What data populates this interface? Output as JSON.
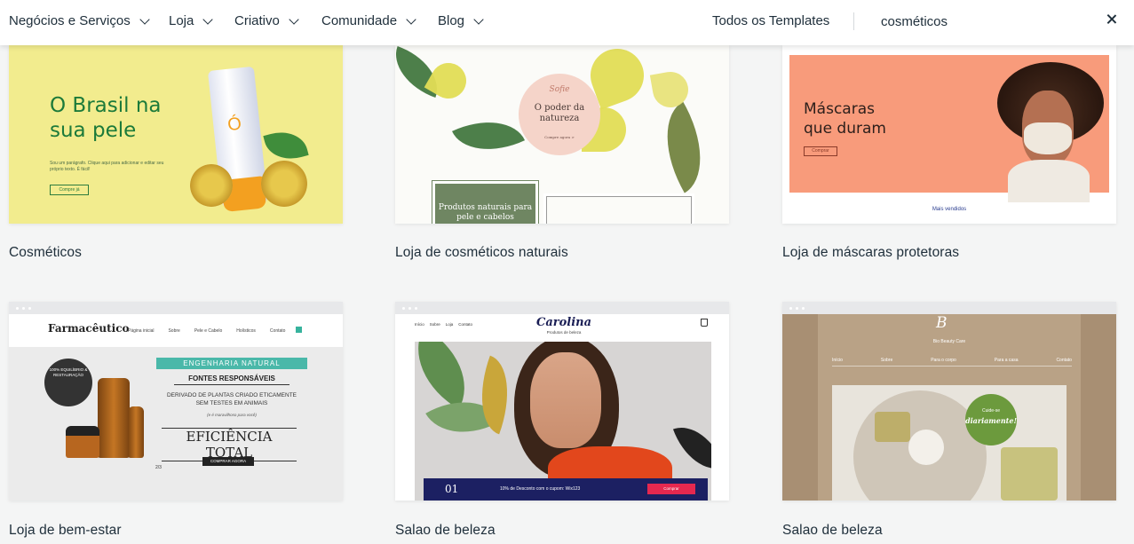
{
  "nav": {
    "items": [
      {
        "label": "Negócios e Serviços"
      },
      {
        "label": "Loja"
      },
      {
        "label": "Criativo"
      },
      {
        "label": "Comunidade"
      },
      {
        "label": "Blog"
      }
    ],
    "all_templates": "Todos os Templates",
    "search_value": "cosméticos"
  },
  "templates": [
    {
      "caption": "Cosméticos",
      "preview": {
        "headline": "O Brasil na sua pele",
        "body": "Sou um parágrafo. Clique aqui para adicionar e editar seu próprio texto. É fácil!",
        "button": "Compre já",
        "logo": "Ó"
      }
    },
    {
      "caption": "Loja de cosméticos naturais",
      "preview": {
        "script": "Sofie",
        "headline": "O poder da natureza",
        "button": "Compre agora >",
        "box": "Produtos naturais para pele e cabelos"
      }
    },
    {
      "caption": "Loja de máscaras protetoras",
      "preview": {
        "headline": "Máscaras que duram",
        "button": "Comprar",
        "footer": "Mais vendidos"
      }
    },
    {
      "caption": "Loja de bem-estar",
      "preview": {
        "brand": "Farmacêutico",
        "links": [
          "Página inicial",
          "Sobre",
          "Pele e Cabelo",
          "Holísticos",
          "Contato"
        ],
        "seal": "100% EQUILÍBRIO & RESTAURAÇÃO",
        "ribbon": "ENGENHARIA NATURAL",
        "fontes": "FONTES RESPONSÁVEIS",
        "derivado": "DERIVADO DE PLANTAS CRIADO ETICAMENTE SEM TESTES EM ANIMAIS",
        "maravilhoso": "(e é maravilhoso para você)",
        "eficiencia": "EFICIÊNCIA TOTAL",
        "button": "COMPRAR AGORA",
        "pager": "2/3"
      }
    },
    {
      "caption": "Salao de beleza",
      "preview": {
        "links": [
          "Início",
          "Sobre",
          "Loja",
          "Contato"
        ],
        "brand": "Carolina",
        "sub": "Produtos de beleza",
        "number": "01",
        "discount": "10% de Desconto com o cupom: Wix123",
        "button": "Comprar"
      }
    },
    {
      "caption": "Salao de beleza",
      "preview": {
        "logo": "B",
        "name": "Bio Beauty Care",
        "menu": [
          "Início",
          "Sobre",
          "Para o corpo",
          "Para a casa",
          "Contato"
        ],
        "cuide": "Cuide-se",
        "diariamente": "diariamente!"
      }
    }
  ]
}
